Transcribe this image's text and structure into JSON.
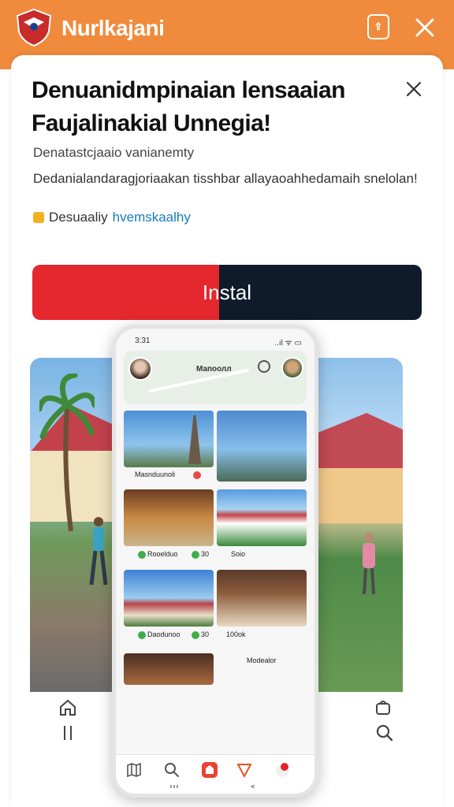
{
  "header": {
    "app_name": "Nurlkajani",
    "logo_icon": "shield-logo-icon",
    "bg_color": "#f08a3c"
  },
  "card": {
    "title": "Denuanidmpinaian lensaaian Faujalinakial Unnegia!",
    "subtitle": "Denatastcjaaio vanianemty",
    "description": "Dedanialandaragjoriaakan tisshbar allayaoahhedamaih snelolan!",
    "rating_prefix": "Desuaaliy",
    "rating_link": "hvemskaalhy",
    "install_label": "Instal"
  },
  "phone": {
    "status_time": "3:31",
    "status_icons": "..ıl ᯤ ▭",
    "map_label": "Мапоолл",
    "tiles": [
      {
        "label": "Masnduunoli"
      },
      {
        "label": "Rooelduo"
      },
      {
        "label": "30"
      },
      {
        "label": "Soio"
      },
      {
        "label": "Daodunoo"
      },
      {
        "label": "30"
      },
      {
        "label": "100ok"
      },
      {
        "label": "Modealor"
      }
    ]
  },
  "colors": {
    "install_red": "#e5272e",
    "install_dark": "#0f1b2b",
    "link_blue": "#1a7bb8"
  }
}
